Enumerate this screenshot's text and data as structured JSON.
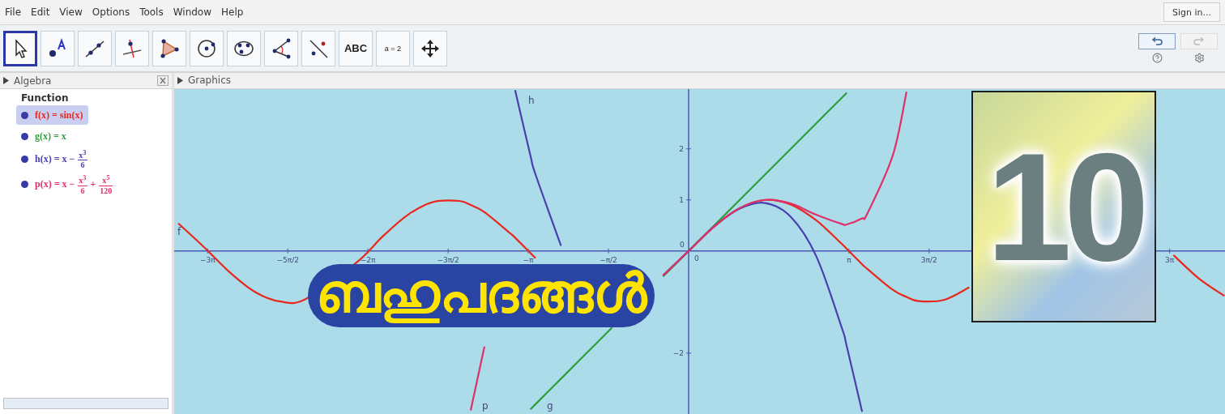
{
  "menu": [
    "File",
    "Edit",
    "View",
    "Options",
    "Tools",
    "Window",
    "Help"
  ],
  "sign_in": "Sign in...",
  "toolbar": {
    "tools": [
      {
        "kind": "move",
        "selected": true
      },
      {
        "kind": "point",
        "selected": false
      },
      {
        "kind": "line",
        "selected": false
      },
      {
        "kind": "perpendicular",
        "selected": false
      },
      {
        "kind": "polygon",
        "selected": false
      },
      {
        "kind": "circle",
        "selected": false
      },
      {
        "kind": "conic",
        "selected": false
      },
      {
        "kind": "angle",
        "selected": false
      },
      {
        "kind": "reflect",
        "selected": false
      },
      {
        "kind": "text",
        "label": "ABC",
        "selected": false
      },
      {
        "kind": "slider",
        "label": "a = 2",
        "selected": false
      },
      {
        "kind": "pan",
        "selected": false
      }
    ]
  },
  "algebra": {
    "title": "Algebra",
    "group": "Function",
    "items": [
      {
        "color": "#e8281e",
        "selected": true,
        "terms": [
          {
            "kind": "text",
            "text": "f(x) = sin(x)"
          }
        ]
      },
      {
        "color": "#2f9e3a",
        "selected": false,
        "terms": [
          {
            "kind": "text",
            "text": "g(x) = x"
          }
        ]
      },
      {
        "color": "#4a3fb0",
        "selected": false,
        "terms": [
          {
            "kind": "text",
            "text": "h(x) = x −"
          },
          {
            "kind": "frac",
            "num": "x$^{3}$",
            "den": "6"
          }
        ]
      },
      {
        "color": "#e0306a",
        "selected": false,
        "terms": [
          {
            "kind": "text",
            "text": "p(x) = x −"
          },
          {
            "kind": "frac",
            "num": "x$^{3}$",
            "den": "6"
          },
          {
            "kind": "text",
            "text": "+"
          },
          {
            "kind": "frac",
            "num": "x$^{5}$",
            "den": "120"
          }
        ]
      }
    ]
  },
  "graphics": {
    "title": "Graphics",
    "overlay_title": "ബഹുപദങ്ങൾ",
    "chapter_badge": "10",
    "chart_data": {
      "type": "line",
      "xlim": [
        -10.08,
        10.51
      ],
      "ylim": [
        -3.24,
        3.17
      ],
      "x": [
        -10,
        -9.5,
        -9,
        -8.5,
        -8,
        -7.5,
        -6.5,
        -6,
        -5.5,
        -5,
        -4.5,
        -4.27,
        -4,
        -3.5,
        -3.4,
        -3.1,
        -3,
        -2.5,
        -2,
        -1.5,
        -1,
        -0.5,
        0,
        0.5,
        1,
        1.5,
        2,
        2.5,
        3,
        3.1,
        3.4,
        3.5,
        4,
        4.27,
        4.5,
        5,
        5.5,
        9.5,
        10,
        10.5
      ],
      "series": [
        {
          "color": "#e8281e",
          "values": [
            0.54,
            0.08,
            -0.41,
            -0.8,
            -0.99,
            -0.94,
            -0.22,
            0.28,
            0.71,
            0.96,
            0.98,
            0.9,
            0.76,
            0.35,
            0.26,
            -0.04,
            -0.14,
            null,
            null,
            null,
            null,
            -0.48,
            0,
            0.48,
            0.84,
            1,
            0.91,
            0.6,
            0.14,
            0.04,
            -0.26,
            -0.35,
            -0.76,
            -0.9,
            -0.98,
            -0.96,
            -0.71,
            -0.08,
            -0.54,
            -0.88
          ]
        },
        {
          "color": "#2f9e3a",
          "values": [
            null,
            null,
            null,
            null,
            null,
            null,
            null,
            null,
            null,
            null,
            null,
            null,
            null,
            null,
            null,
            -3.1,
            -3,
            -2.5,
            -2,
            -1.5,
            null,
            -0.5,
            0,
            0.5,
            1,
            1.5,
            2,
            2.5,
            3,
            3.1,
            null,
            null,
            null,
            null,
            null,
            null,
            null,
            null,
            null,
            null
          ]
        },
        {
          "color": "#4a3fb0",
          "values": [
            null,
            null,
            null,
            null,
            null,
            null,
            null,
            null,
            null,
            null,
            null,
            null,
            null,
            null,
            3.15,
            1.87,
            1.5,
            0.1,
            null,
            null,
            null,
            -0.48,
            0,
            0.48,
            0.83,
            0.94,
            0.67,
            -0.1,
            -1.5,
            -1.87,
            -3.15,
            null,
            null,
            null,
            null,
            null,
            null,
            null,
            null,
            null
          ]
        },
        {
          "color": "#e0306a",
          "values": [
            null,
            null,
            null,
            null,
            null,
            null,
            null,
            null,
            null,
            null,
            null,
            -3.12,
            -1.87,
            null,
            null,
            null,
            null,
            null,
            null,
            null,
            null,
            -0.48,
            0,
            0.48,
            0.84,
            1,
            0.93,
            0.71,
            0.53,
            0.52,
            0.64,
            0.73,
            1.87,
            3.12,
            null,
            null,
            null,
            null,
            null,
            null
          ]
        }
      ],
      "xticks": [
        {
          "value": -9.425,
          "label": "−3π"
        },
        {
          "value": -7.854,
          "label": "−5π/2"
        },
        {
          "value": -6.283,
          "label": "−2π"
        },
        {
          "value": -4.712,
          "label": "−3π/2"
        },
        {
          "value": -3.142,
          "label": "−π"
        },
        {
          "value": -1.571,
          "label": "−π/2"
        },
        {
          "value": 3.142,
          "label": "π"
        },
        {
          "value": 4.712,
          "label": "3π/2"
        },
        {
          "value": 9.425,
          "label": "3π"
        }
      ],
      "yticks": [
        {
          "value": -2,
          "label": "−2"
        },
        {
          "value": 1,
          "label": "1"
        },
        {
          "value": 2,
          "label": "2"
        }
      ]
    },
    "origin_labels": [
      "0",
      "0"
    ],
    "curve_labels": [
      "h",
      "f",
      "p",
      "g"
    ]
  }
}
